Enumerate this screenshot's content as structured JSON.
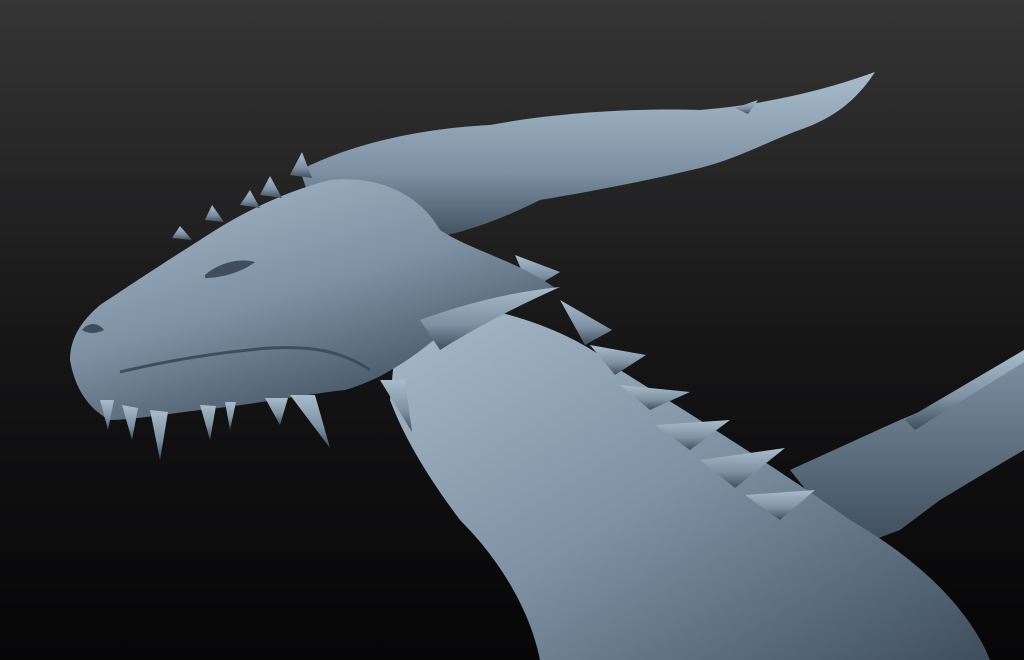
{
  "scene": {
    "subject": "dragon-sculpt",
    "colors": {
      "background_top": "#353536",
      "background_bottom": "#060607",
      "clay_light": "#a9bccb",
      "clay_mid": "#7d91a3",
      "clay_dark": "#3f4e5c",
      "clay_shadow": "#26303a"
    }
  }
}
